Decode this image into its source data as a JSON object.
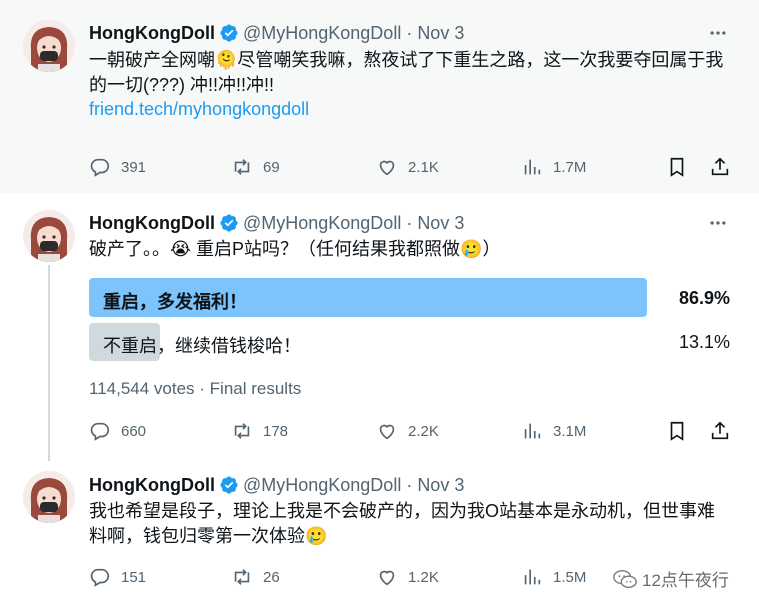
{
  "tweets": [
    {
      "name": "HongKongDoll",
      "handle": "@MyHongKongDoll",
      "dot": "·",
      "date": "Nov 3",
      "text": "一朝破产全网嘲🫠尽管嘲笑我嘛，熬夜试了下重生之路，这一次我要夺回属于我的一切(???) 冲!!冲!!冲!!",
      "link": "friend.tech/myhongkongdoll",
      "replies": "391",
      "retweets": "69",
      "likes": "2.1K",
      "views": "1.7M"
    },
    {
      "name": "HongKongDoll",
      "handle": "@MyHongKongDoll",
      "dot": "·",
      "date": "Nov 3",
      "text": "破产了。。😭 重启P站吗？（任何结果我都照做🥲）",
      "poll": {
        "options": [
          {
            "label": "重启，多发福利！",
            "percent": "86.9%",
            "value": 86.9
          },
          {
            "label": "不重启，继续借钱梭哈！",
            "percent": "13.1%",
            "value": 13.1
          }
        ],
        "meta": "114,544 votes · Final results"
      },
      "replies": "660",
      "retweets": "178",
      "likes": "2.2K",
      "views": "3.1M"
    },
    {
      "name": "HongKongDoll",
      "handle": "@MyHongKongDoll",
      "dot": "·",
      "date": "Nov 3",
      "text": "我也希望是段子，理论上我是不会破产的，因为我O站基本是永动机，但世事难料啊，钱包归零第一次体验🥲",
      "replies": "151",
      "retweets": "26",
      "likes": "1.2K",
      "views": "1.5M"
    }
  ],
  "watermark": "12点午夜行",
  "colors": {
    "accent": "#1d9bf0",
    "poll_winner": "#7cc4fb",
    "poll_other": "#cfd9de",
    "muted": "#536471"
  },
  "icons": [
    "verified-badge-icon",
    "more-options-icon",
    "reply-icon",
    "retweet-icon",
    "like-icon",
    "views-icon",
    "bookmark-icon",
    "share-icon",
    "wechat-icon"
  ]
}
